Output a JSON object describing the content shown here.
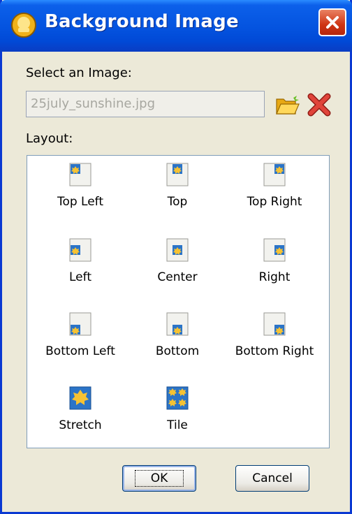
{
  "window": {
    "title": "Background Image"
  },
  "image_select": {
    "label": "Select an Image:",
    "file_value": "25july_sunshine.jpg"
  },
  "layout": {
    "label": "Layout:",
    "options": [
      {
        "label": "Top Left",
        "icon": "align-top-left-icon"
      },
      {
        "label": "Top",
        "icon": "align-top-icon"
      },
      {
        "label": "Top Right",
        "icon": "align-top-right-icon"
      },
      {
        "label": "Left",
        "icon": "align-left-icon"
      },
      {
        "label": "Center",
        "icon": "align-center-icon"
      },
      {
        "label": "Right",
        "icon": "align-right-icon"
      },
      {
        "label": "Bottom Left",
        "icon": "align-bottom-left-icon"
      },
      {
        "label": "Bottom",
        "icon": "align-bottom-icon"
      },
      {
        "label": "Bottom Right",
        "icon": "align-bottom-right-icon"
      },
      {
        "label": "Stretch",
        "icon": "stretch-icon"
      },
      {
        "label": "Tile",
        "icon": "tile-icon"
      }
    ]
  },
  "buttons": {
    "ok": "OK",
    "cancel": "Cancel"
  },
  "colors": {
    "titlebar": "#0453df",
    "window_bg": "#ece9d8",
    "thumb_fill": "#2b74c8",
    "leaf": "#f6c233"
  }
}
